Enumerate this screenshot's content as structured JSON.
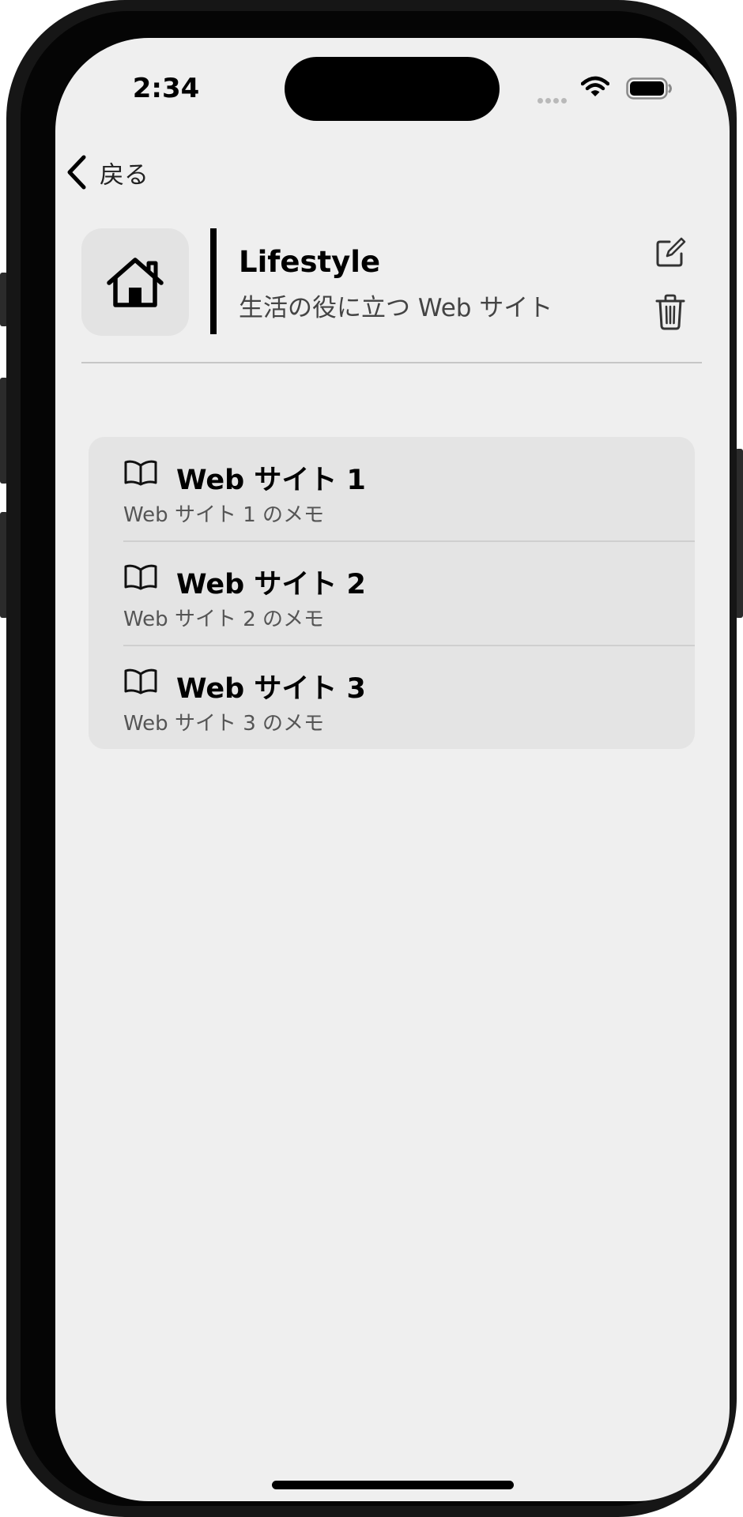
{
  "status_bar": {
    "time": "2:34"
  },
  "nav": {
    "back_label": "戻る"
  },
  "category": {
    "title": "Lifestyle",
    "subtitle": "生活の役に立つ Web サイト",
    "icon": "house-icon"
  },
  "websites": [
    {
      "title": "Web サイト 1",
      "memo": "Web サイト 1 のメモ",
      "icon": "book-icon"
    },
    {
      "title": "Web サイト 2",
      "memo": "Web サイト 2 のメモ",
      "icon": "book-icon"
    },
    {
      "title": "Web サイト 3",
      "memo": "Web サイト 3 のメモ",
      "icon": "book-icon"
    }
  ]
}
